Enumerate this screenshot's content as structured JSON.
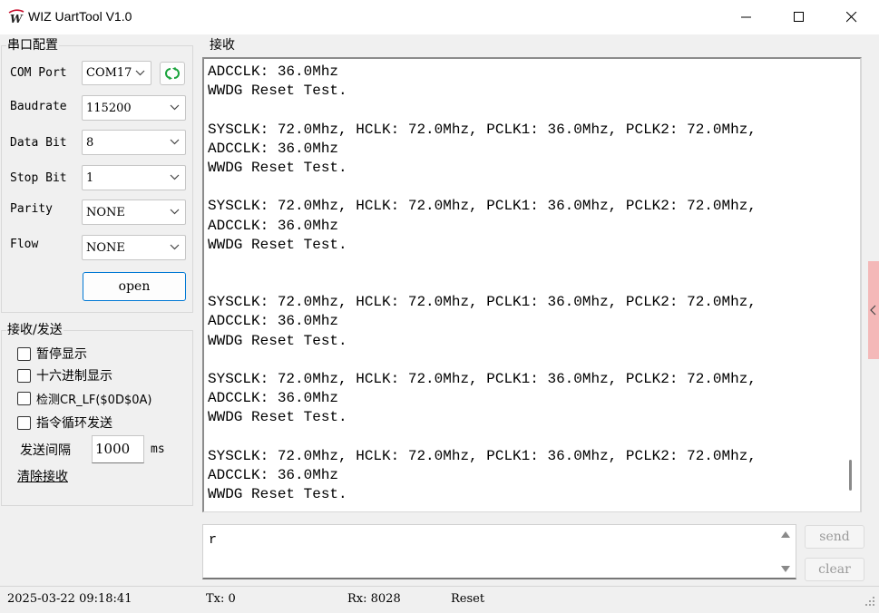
{
  "window": {
    "title": "WIZ UartTool V1.0"
  },
  "serial_config": {
    "title": "串口配置",
    "com_port": {
      "label": "COM Port",
      "value": "COM17"
    },
    "baudrate": {
      "label": "Baudrate",
      "value": "115200"
    },
    "data_bit": {
      "label": "Data Bit",
      "value": "8"
    },
    "stop_bit": {
      "label": "Stop Bit",
      "value": "1"
    },
    "parity": {
      "label": "Parity",
      "value": "NONE"
    },
    "flow": {
      "label": "Flow",
      "value": "NONE"
    },
    "open_label": "open"
  },
  "recv_send": {
    "title": "接收/发送",
    "pause_display": "暂停显示",
    "hex_display": "十六进制显示",
    "detect_crlf": "检测CR_LF($0D$0A)",
    "loop_send": "指令循环发送",
    "interval_label": "发送间隔",
    "interval_value": "1000",
    "interval_unit": "ms",
    "clear_recv": "清除接收"
  },
  "receive": {
    "title": "接收",
    "lines": [
      "ADCCLK: 36.0Mhz",
      "WWDG Reset Test.",
      "",
      "SYSCLK: 72.0Mhz, HCLK: 72.0Mhz, PCLK1: 36.0Mhz, PCLK2: 72.0Mhz,",
      "ADCCLK: 36.0Mhz",
      "WWDG Reset Test.",
      "",
      "SYSCLK: 72.0Mhz, HCLK: 72.0Mhz, PCLK1: 36.0Mhz, PCLK2: 72.0Mhz,",
      "ADCCLK: 36.0Mhz",
      "WWDG Reset Test.",
      "",
      "",
      "SYSCLK: 72.0Mhz, HCLK: 72.0Mhz, PCLK1: 36.0Mhz, PCLK2: 72.0Mhz,",
      "ADCCLK: 36.0Mhz",
      "WWDG Reset Test.",
      "",
      "SYSCLK: 72.0Mhz, HCLK: 72.0Mhz, PCLK1: 36.0Mhz, PCLK2: 72.0Mhz,",
      "ADCCLK: 36.0Mhz",
      "WWDG Reset Test.",
      "",
      "SYSCLK: 72.0Mhz, HCLK: 72.0Mhz, PCLK1: 36.0Mhz, PCLK2: 72.0Mhz,",
      "ADCCLK: 36.0Mhz",
      "WWDG Reset Test."
    ]
  },
  "send": {
    "text": "r",
    "send_label": "send",
    "clear_label": "clear"
  },
  "status": {
    "timestamp": "2025-03-22 09:18:41",
    "tx": "Tx: 0",
    "rx": "Rx: 8028",
    "reset": "Reset"
  },
  "colors": {
    "accent": "#0078d4",
    "refresh_icon": "#1aa33c",
    "side_tab": "#f4b8b8"
  }
}
